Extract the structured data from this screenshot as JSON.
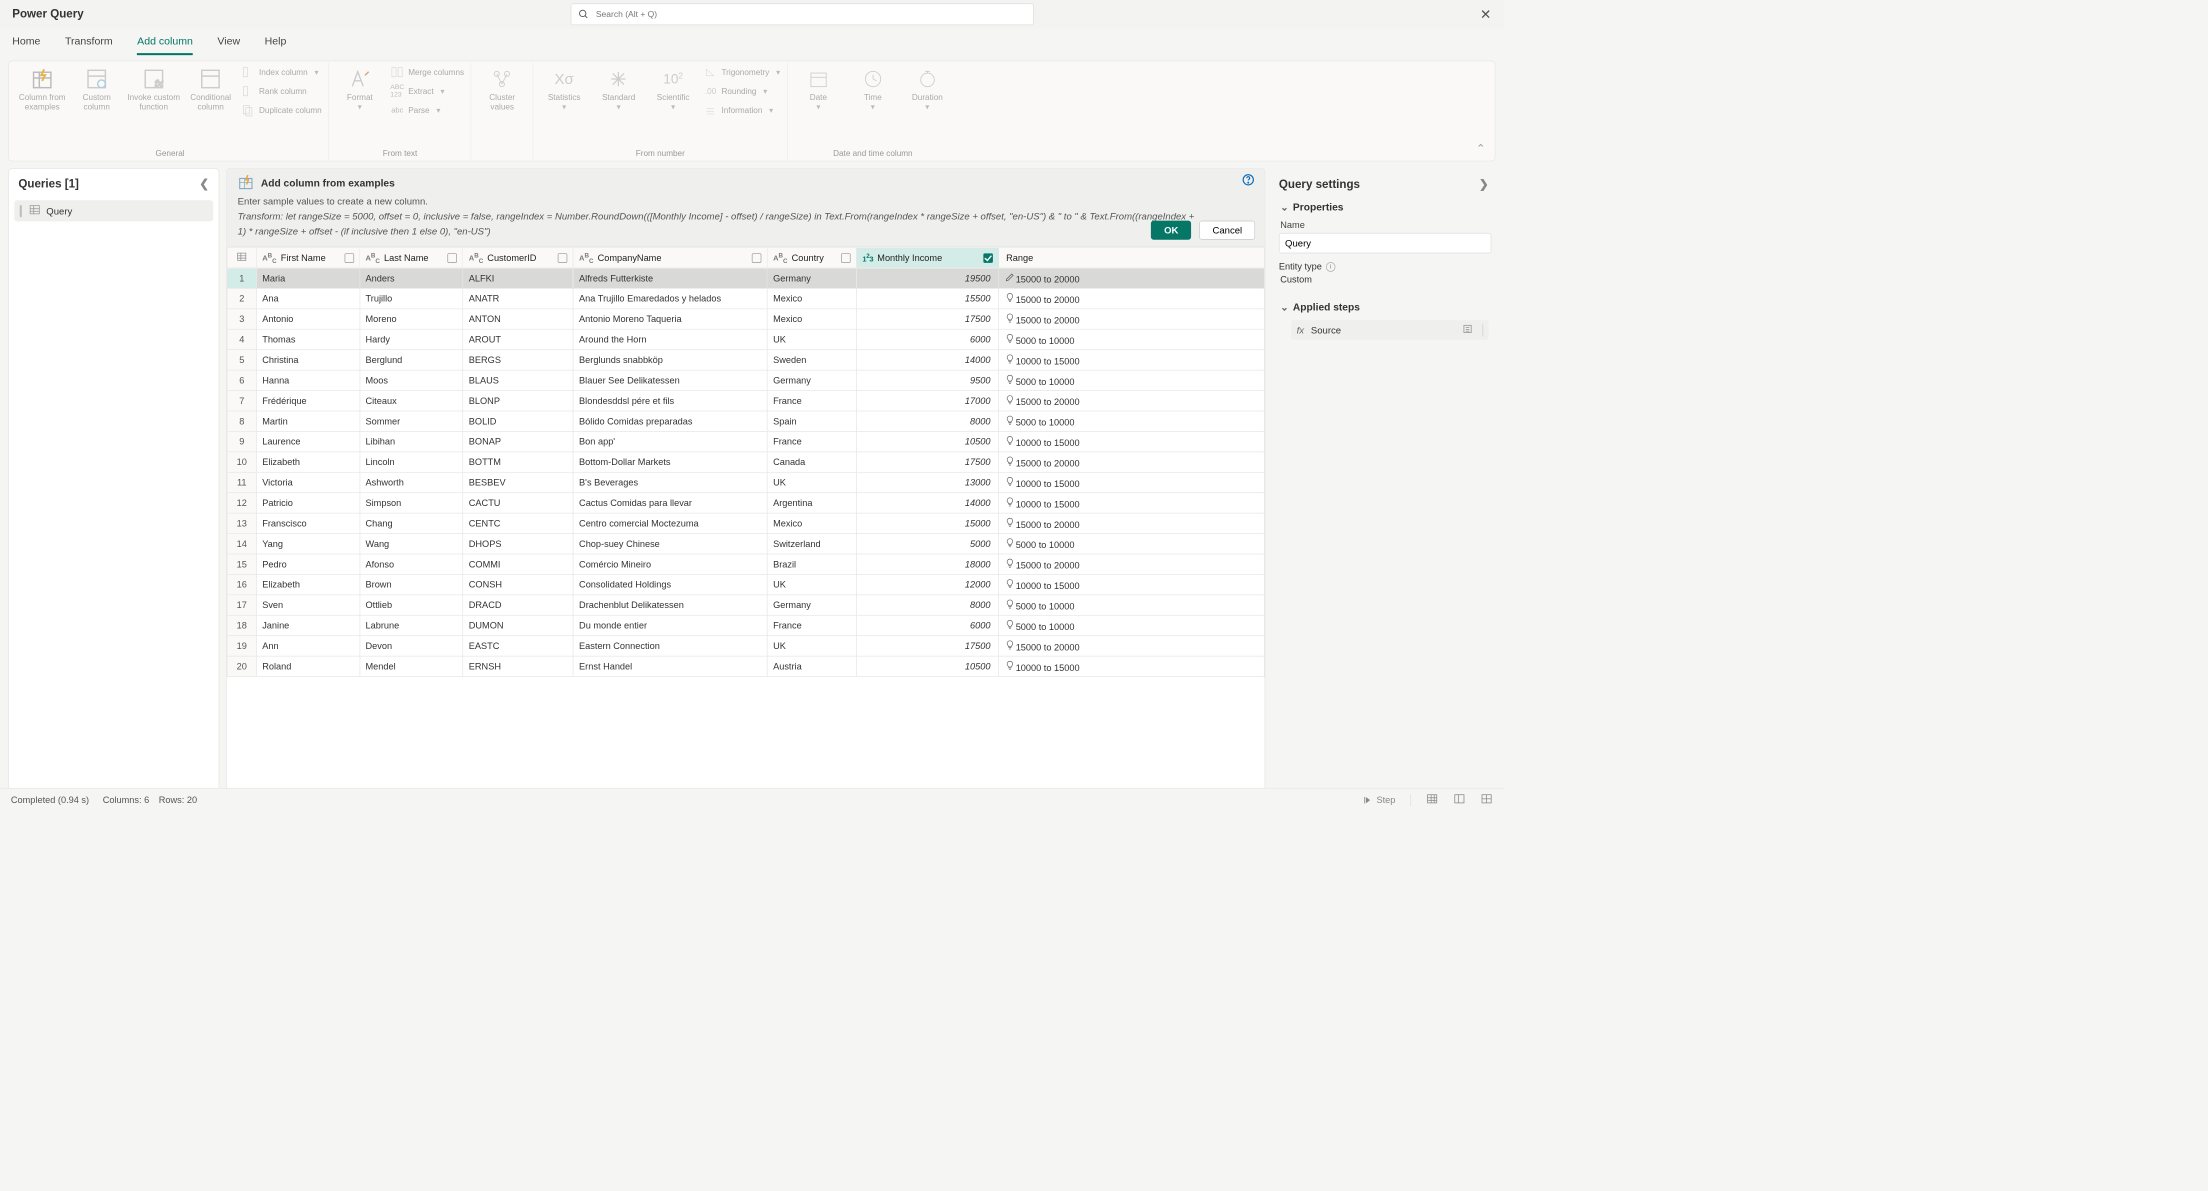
{
  "app": {
    "title": "Power Query"
  },
  "search": {
    "placeholder": "Search (Alt + Q)"
  },
  "tabs": [
    "Home",
    "Transform",
    "Add column",
    "View",
    "Help"
  ],
  "active_tab": "Add column",
  "ribbon": {
    "groups": {
      "general": {
        "label": "General",
        "btns": {
          "col_from_examples": "Column from\nexamples",
          "custom_column": "Custom\ncolumn",
          "invoke": "Invoke custom\nfunction",
          "conditional": "Conditional\ncolumn",
          "index": "Index column",
          "rank": "Rank column",
          "duplicate": "Duplicate column"
        }
      },
      "from_text": {
        "label": "From text",
        "btns": {
          "format": "Format",
          "merge": "Merge columns",
          "extract": "Extract",
          "parse": "Parse"
        }
      },
      "cluster": {
        "btns": {
          "cluster": "Cluster\nvalues"
        }
      },
      "from_number": {
        "label": "From number",
        "btns": {
          "statistics": "Statistics",
          "standard": "Standard",
          "scientific": "Scientific",
          "trig": "Trigonometry",
          "rounding": "Rounding",
          "information": "Information"
        }
      },
      "datetime": {
        "label": "Date and time column",
        "btns": {
          "date": "Date",
          "time": "Time",
          "duration": "Duration"
        }
      }
    }
  },
  "queries": {
    "header": "Queries [1]",
    "items": [
      "Query"
    ]
  },
  "example_panel": {
    "title": "Add column from examples",
    "desc": "Enter sample values to create a new column.",
    "transform": "Transform: let rangeSize = 5000, offset = 0, inclusive = false, rangeIndex = Number.RoundDown(([Monthly Income] - offset) / rangeSize) in Text.From(rangeIndex * rangeSize + offset, \"en-US\") & \" to \" & Text.From((rangeIndex + 1) * rangeSize + offset - (if inclusive then 1 else 0), \"en-US\")",
    "ok": "OK",
    "cancel": "Cancel"
  },
  "columns": {
    "first_name": "First Name",
    "last_name": "Last Name",
    "customer_id": "CustomerID",
    "company": "CompanyName",
    "country": "Country",
    "income": "Monthly Income",
    "range": "Range"
  },
  "rows": [
    {
      "n": 1,
      "fn": "Maria",
      "ln": "Anders",
      "cid": "ALFKI",
      "cn": "Alfreds Futterkiste",
      "ctry": "Germany",
      "inc": "19500",
      "rg": "15000 to 20000",
      "sel": true
    },
    {
      "n": 2,
      "fn": "Ana",
      "ln": "Trujillo",
      "cid": "ANATR",
      "cn": "Ana Trujillo Emaredados y helados",
      "ctry": "Mexico",
      "inc": "15500",
      "rg": "15000 to 20000"
    },
    {
      "n": 3,
      "fn": "Antonio",
      "ln": "Moreno",
      "cid": "ANTON",
      "cn": "Antonio Moreno Taqueria",
      "ctry": "Mexico",
      "inc": "17500",
      "rg": "15000 to 20000"
    },
    {
      "n": 4,
      "fn": "Thomas",
      "ln": "Hardy",
      "cid": "AROUT",
      "cn": "Around the Horn",
      "ctry": "UK",
      "inc": "6000",
      "rg": "5000 to 10000"
    },
    {
      "n": 5,
      "fn": "Christina",
      "ln": "Berglund",
      "cid": "BERGS",
      "cn": "Berglunds snabbköp",
      "ctry": "Sweden",
      "inc": "14000",
      "rg": "10000 to 15000"
    },
    {
      "n": 6,
      "fn": "Hanna",
      "ln": "Moos",
      "cid": "BLAUS",
      "cn": "Blauer See Delikatessen",
      "ctry": "Germany",
      "inc": "9500",
      "rg": "5000 to 10000"
    },
    {
      "n": 7,
      "fn": "Frédérique",
      "ln": "Citeaux",
      "cid": "BLONP",
      "cn": "Blondesddsl pére et fils",
      "ctry": "France",
      "inc": "17000",
      "rg": "15000 to 20000"
    },
    {
      "n": 8,
      "fn": "Martin",
      "ln": "Sommer",
      "cid": "BOLID",
      "cn": "Bólido Comidas preparadas",
      "ctry": "Spain",
      "inc": "8000",
      "rg": "5000 to 10000"
    },
    {
      "n": 9,
      "fn": "Laurence",
      "ln": "Libihan",
      "cid": "BONAP",
      "cn": "Bon app'",
      "ctry": "France",
      "inc": "10500",
      "rg": "10000 to 15000"
    },
    {
      "n": 10,
      "fn": "Elizabeth",
      "ln": "Lincoln",
      "cid": "BOTTM",
      "cn": "Bottom-Dollar Markets",
      "ctry": "Canada",
      "inc": "17500",
      "rg": "15000 to 20000"
    },
    {
      "n": 11,
      "fn": "Victoria",
      "ln": "Ashworth",
      "cid": "BESBEV",
      "cn": "B's Beverages",
      "ctry": "UK",
      "inc": "13000",
      "rg": "10000 to 15000"
    },
    {
      "n": 12,
      "fn": "Patricio",
      "ln": "Simpson",
      "cid": "CACTU",
      "cn": "Cactus Comidas para llevar",
      "ctry": "Argentina",
      "inc": "14000",
      "rg": "10000 to 15000"
    },
    {
      "n": 13,
      "fn": "Franscisco",
      "ln": "Chang",
      "cid": "CENTC",
      "cn": "Centro comercial Moctezuma",
      "ctry": "Mexico",
      "inc": "15000",
      "rg": "15000 to 20000"
    },
    {
      "n": 14,
      "fn": "Yang",
      "ln": "Wang",
      "cid": "DHOPS",
      "cn": "Chop-suey Chinese",
      "ctry": "Switzerland",
      "inc": "5000",
      "rg": "5000 to 10000"
    },
    {
      "n": 15,
      "fn": "Pedro",
      "ln": "Afonso",
      "cid": "COMMI",
      "cn": "Comércio Mineiro",
      "ctry": "Brazil",
      "inc": "18000",
      "rg": "15000 to 20000"
    },
    {
      "n": 16,
      "fn": "Elizabeth",
      "ln": "Brown",
      "cid": "CONSH",
      "cn": "Consolidated Holdings",
      "ctry": "UK",
      "inc": "12000",
      "rg": "10000 to 15000"
    },
    {
      "n": 17,
      "fn": "Sven",
      "ln": "Ottlieb",
      "cid": "DRACD",
      "cn": "Drachenblut Delikatessen",
      "ctry": "Germany",
      "inc": "8000",
      "rg": "5000 to 10000"
    },
    {
      "n": 18,
      "fn": "Janine",
      "ln": "Labrune",
      "cid": "DUMON",
      "cn": "Du monde entier",
      "ctry": "France",
      "inc": "6000",
      "rg": "5000 to 10000"
    },
    {
      "n": 19,
      "fn": "Ann",
      "ln": "Devon",
      "cid": "EASTC",
      "cn": "Eastern Connection",
      "ctry": "UK",
      "inc": "17500",
      "rg": "15000 to 20000"
    },
    {
      "n": 20,
      "fn": "Roland",
      "ln": "Mendel",
      "cid": "ERNSH",
      "cn": "Ernst Handel",
      "ctry": "Austria",
      "inc": "10500",
      "rg": "10000 to 15000"
    }
  ],
  "settings": {
    "header": "Query settings",
    "properties": "Properties",
    "name_label": "Name",
    "name_value": "Query",
    "entity_label": "Entity type",
    "entity_value": "Custom",
    "steps_header": "Applied steps",
    "steps": [
      "Source"
    ]
  },
  "status": {
    "completed": "Completed (0.94 s)",
    "cols": "Columns: 6",
    "rows": "Rows: 20",
    "step": "Step"
  }
}
